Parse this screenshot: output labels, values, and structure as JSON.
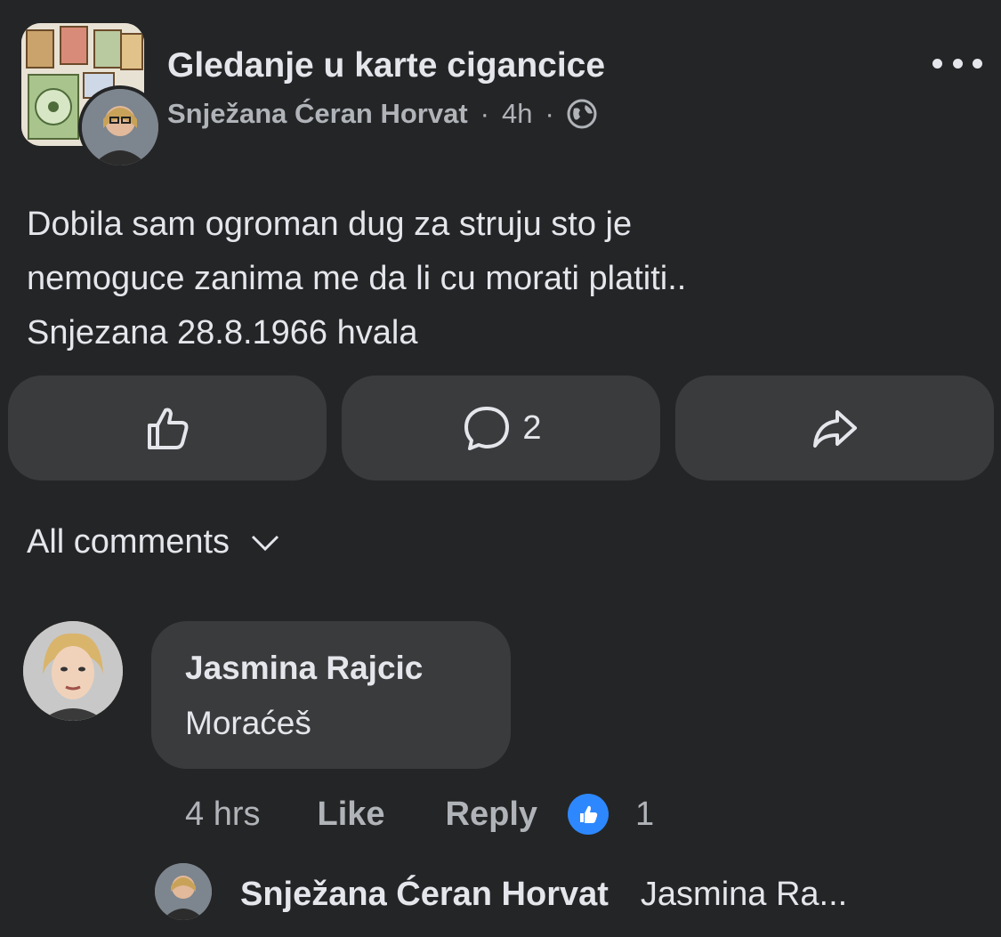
{
  "post": {
    "group_name": "Gledanje u karte cigancice",
    "author": "Snježana Ćeran Horvat",
    "separator": "·",
    "time": "4h",
    "privacy_icon": "globe-icon",
    "menu_icon": "more-options-icon",
    "text_lines": [
      "Dobila sam ogroman dug za struju sto je",
      "nemoguce zanima me da li cu morati platiti..",
      "Snjezana 28.8.1966 hvala"
    ]
  },
  "actions": {
    "like_icon": "thumbs-up-icon",
    "comment_icon": "comment-icon",
    "comment_count": "2",
    "share_icon": "share-icon"
  },
  "comments_filter": {
    "label": "All comments",
    "icon": "chevron-down-icon"
  },
  "comment": {
    "author": "Jasmina Rajcic",
    "text": "Moraćeš",
    "time": "4 hrs",
    "like_label": "Like",
    "reply_label": "Reply",
    "reaction_count": "1"
  },
  "reply_preview": {
    "author": "Snježana Ćeran Horvat",
    "text": "Jasmina Ra..."
  },
  "colors": {
    "background": "#242526",
    "surface": "#3a3b3c",
    "text": "#e4e6eb",
    "secondary_text": "#b0b3b8",
    "like_blue": "#2d88ff"
  }
}
